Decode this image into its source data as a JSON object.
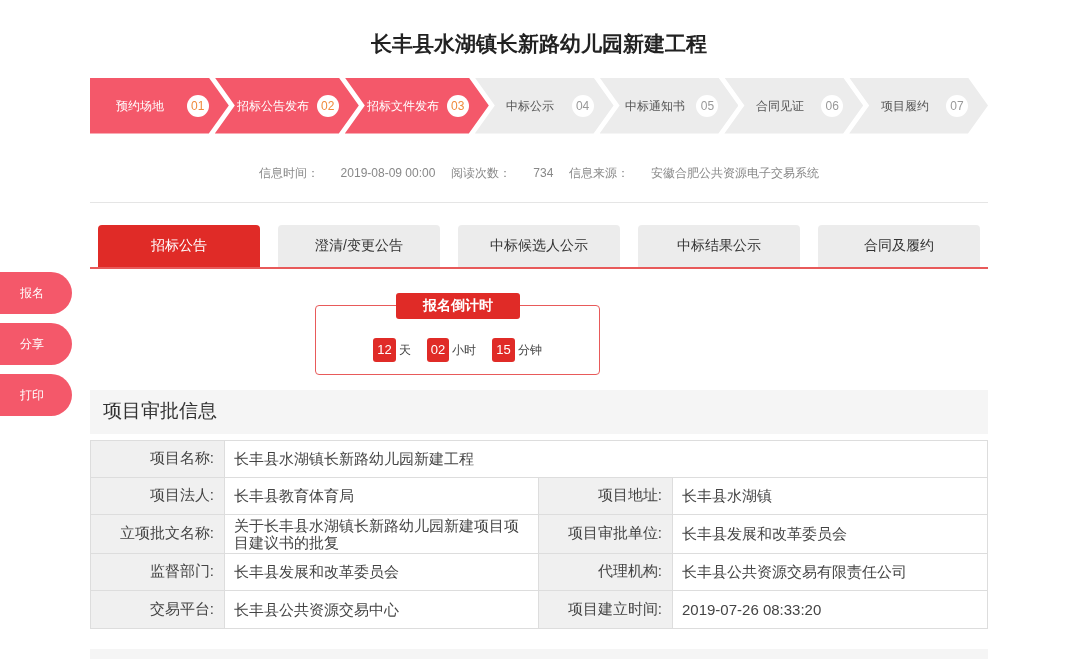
{
  "title": "长丰县水湖镇长新路幼儿园新建工程",
  "steps": [
    {
      "label": "预约场地",
      "number": "01",
      "done": true
    },
    {
      "label": "招标公告发布",
      "number": "02",
      "done": true
    },
    {
      "label": "招标文件发布",
      "number": "03",
      "done": true
    },
    {
      "label": "中标公示",
      "number": "04",
      "done": false
    },
    {
      "label": "中标通知书",
      "number": "05",
      "done": false
    },
    {
      "label": "合同见证",
      "number": "06",
      "done": false
    },
    {
      "label": "项目履约",
      "number": "07",
      "done": false
    }
  ],
  "info": [
    {
      "label": "信息时间：",
      "value": "2019-08-09 00:00"
    },
    {
      "label": "阅读次数：",
      "value": "734"
    },
    {
      "label": "信息来源：",
      "value": "安徽合肥公共资源电子交易系统"
    }
  ],
  "tabs": [
    {
      "label": "招标公告",
      "selected": true
    },
    {
      "label": "澄清/变更公告",
      "selected": false
    },
    {
      "label": "中标候选人公示",
      "selected": false
    },
    {
      "label": "中标结果公示",
      "selected": false
    },
    {
      "label": "合同及履约",
      "selected": false
    }
  ],
  "side_buttons": [
    "报名",
    "分享",
    "打印"
  ],
  "countdown": {
    "title": "报名倒计时",
    "parts": [
      {
        "value": "12",
        "unit": "天"
      },
      {
        "value": "02",
        "unit": "小时"
      },
      {
        "value": "15",
        "unit": "分钟"
      }
    ]
  },
  "section_title": "项目审批信息",
  "table": {
    "rows": [
      {
        "kind": "full",
        "cells": [
          {
            "label": "项目名称:",
            "value": "长丰县水湖镇长新路幼儿园新建工程"
          }
        ]
      },
      {
        "kind": "pair",
        "cells": [
          {
            "label": "项目法人:",
            "value": "长丰县教育体育局"
          },
          {
            "label": "项目地址:",
            "value": "长丰县水湖镇"
          }
        ]
      },
      {
        "kind": "pair",
        "cells": [
          {
            "label": "立项批文名称:",
            "value": "关于长丰县水湖镇长新路幼儿园新建项目项目建议书的批复"
          },
          {
            "label": "项目审批单位:",
            "value": "长丰县发展和改革委员会"
          }
        ]
      },
      {
        "kind": "pair",
        "cells": [
          {
            "label": "监督部门:",
            "value": "长丰县发展和改革委员会"
          },
          {
            "label": "代理机构:",
            "value": "长丰县公共资源交易有限责任公司"
          }
        ]
      },
      {
        "kind": "pair",
        "cells": [
          {
            "label": "交易平台:",
            "value": "长丰县公共资源交易中心"
          },
          {
            "label": "项目建立时间:",
            "value": "2019-07-26 08:33:20"
          }
        ]
      }
    ]
  }
}
